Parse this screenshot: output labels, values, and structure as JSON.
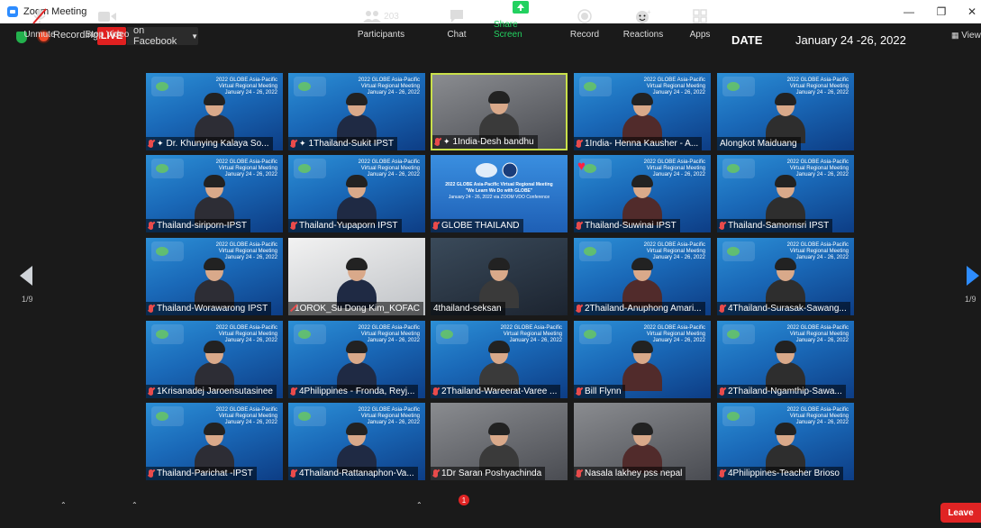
{
  "window": {
    "title": "Zoom Meeting",
    "controls": [
      "—",
      "❐",
      "✕"
    ]
  },
  "topbar": {
    "recording_label": "Recording",
    "live_label": "LIVE",
    "facebook_label": "on Facebook",
    "date_label": "DATE",
    "date_value": "January 24 -26, 2022",
    "view_label": "View"
  },
  "gallery": {
    "page_left": "1/9",
    "page_right": "1/9",
    "tile_bg_title": "2022 GLOBE Asia-Pacific Virtual Regional Meeting",
    "tile_bg_date": "January 24 - 26, 2022",
    "slide": {
      "title": "2022 GLOBE Asia-Pacific Virtual Regional Meeting",
      "subtitle": "\"We Learn We Do with GLOBE\"",
      "date": "January 24 - 26, 2022 via ZOOM VDO Conference"
    },
    "tiles": [
      {
        "name": "Dr. Khunying Kalaya So...",
        "muted": true,
        "pinned": true,
        "kind": "bg"
      },
      {
        "name": "1Thailand-Sukit IPST",
        "muted": true,
        "pinned": true,
        "kind": "bg"
      },
      {
        "name": "1India-Desh bandhu",
        "muted": true,
        "pinned": true,
        "kind": "cam",
        "active": true
      },
      {
        "name": "1India- Henna Kausher - A...",
        "muted": true,
        "pinned": false,
        "kind": "bg"
      },
      {
        "name": "Alongkot Maiduang",
        "muted": false,
        "pinned": false,
        "kind": "bg"
      },
      {
        "name": "Thailand-siriporn-IPST",
        "muted": true,
        "pinned": false,
        "kind": "bg"
      },
      {
        "name": "Thailand-Yupaporn IPST",
        "muted": true,
        "pinned": false,
        "kind": "bg"
      },
      {
        "name": "GLOBE THAILAND",
        "muted": true,
        "pinned": false,
        "kind": "slide"
      },
      {
        "name": "Thailand-Suwinai IPST",
        "muted": true,
        "pinned": false,
        "kind": "bg",
        "heart": true
      },
      {
        "name": "Thailand-Samornsri IPST",
        "muted": true,
        "pinned": false,
        "kind": "bg"
      },
      {
        "name": "Thailand-Worawarong IPST",
        "muted": true,
        "pinned": false,
        "kind": "bg"
      },
      {
        "name": "1OROK_Su Dong Kim_KOFAC",
        "muted": true,
        "pinned": false,
        "kind": "cam2"
      },
      {
        "name": "4thailand-seksan",
        "muted": false,
        "pinned": false,
        "kind": "cam3"
      },
      {
        "name": "2Thailand-Anuphong Amari...",
        "muted": true,
        "pinned": false,
        "kind": "bg"
      },
      {
        "name": "4Thailand-Surasak-Sawang...",
        "muted": true,
        "pinned": false,
        "kind": "bg"
      },
      {
        "name": "1Krisanadej Jaroensutasinee",
        "muted": true,
        "pinned": false,
        "kind": "bg"
      },
      {
        "name": "4Philippines - Fronda, Reyj...",
        "muted": true,
        "pinned": false,
        "kind": "bg"
      },
      {
        "name": "2Thailand-Wareerat-Varee ...",
        "muted": true,
        "pinned": false,
        "kind": "bg"
      },
      {
        "name": "Bill Flynn",
        "muted": true,
        "pinned": false,
        "kind": "bg"
      },
      {
        "name": "2Thailand-Ngamthip-Sawa...",
        "muted": true,
        "pinned": false,
        "kind": "bg"
      },
      {
        "name": "Thailand-Parichat -IPST",
        "muted": true,
        "pinned": false,
        "kind": "bg"
      },
      {
        "name": "4Thailand-Rattanaphon-Va...",
        "muted": true,
        "pinned": false,
        "kind": "bg"
      },
      {
        "name": "1Dr Saran Poshyachinda",
        "muted": true,
        "pinned": false,
        "kind": "cam"
      },
      {
        "name": "Nasala lakhey pss nepal",
        "muted": true,
        "pinned": false,
        "kind": "cam"
      },
      {
        "name": "4Philippines-Teacher Brioso",
        "muted": true,
        "pinned": false,
        "kind": "bg"
      }
    ]
  },
  "toolbar": {
    "unmute": "Unmute",
    "stop_video": "Stop Video",
    "participants": "Participants",
    "participants_count": "203",
    "chat": "Chat",
    "chat_badge": "1",
    "share_screen": "Share Screen",
    "record": "Record",
    "reactions": "Reactions",
    "apps": "Apps",
    "leave": "Leave"
  },
  "colors": {
    "accent_green": "#23d160",
    "live_red": "#e02020",
    "active_border": "#c9e04a"
  }
}
